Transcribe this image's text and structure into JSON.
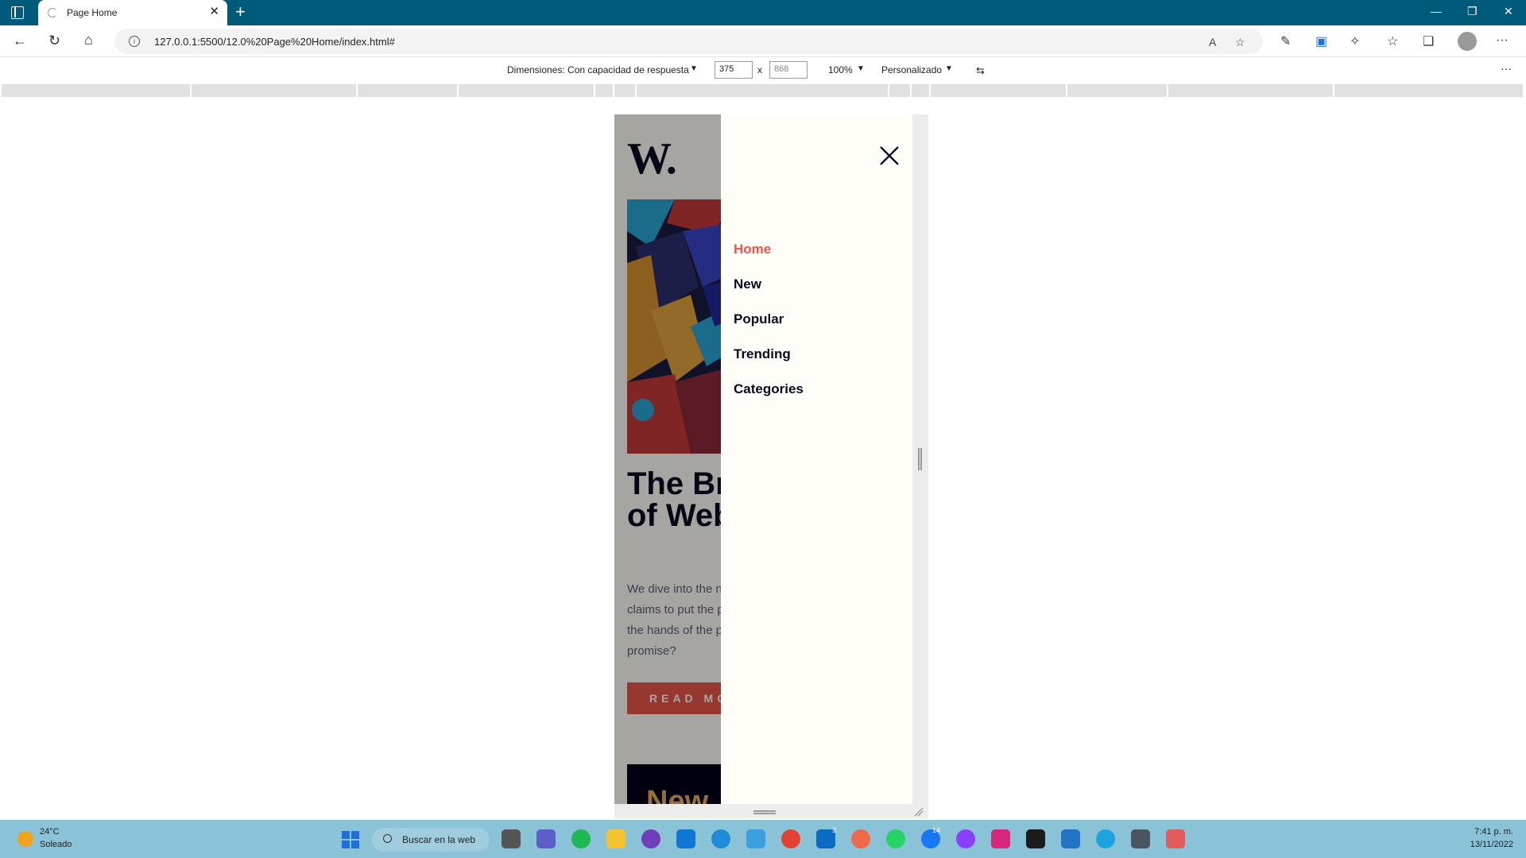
{
  "browser": {
    "tab_title": "Page Home",
    "tab_close": "✕",
    "new_tab": "+",
    "url": "127.0.0.1:5500/12.0%20Page%20Home/index.html#",
    "window_controls": [
      "—",
      "❐",
      "✕"
    ]
  },
  "devtools": {
    "dimensions_label": "Dimensiones: Con capacidad de respuesta",
    "width_value": "375",
    "height_value": "868",
    "times": "x",
    "zoom": "100%",
    "throttle": "Personalizado",
    "more": "···"
  },
  "page": {
    "logo": "W.",
    "headline": "The Bright Future of Web 3.0?",
    "lede": "We dive into the next evolution of the web that claims to put the power of the platforms back into the hands of the people. But is it really fulfilling its promise?",
    "read_more": "READ MORE",
    "new_section_title": "New",
    "menu": {
      "items": [
        {
          "label": "Home",
          "active": true
        },
        {
          "label": "New",
          "active": false
        },
        {
          "label": "Popular",
          "active": false
        },
        {
          "label": "Trending",
          "active": false
        },
        {
          "label": "Categories",
          "active": false
        }
      ]
    },
    "colors": {
      "accent": "#e9564a",
      "dark": "#0a0a1f",
      "cream": "#fffdf7",
      "gold": "#e9ab53"
    }
  },
  "taskbar": {
    "weather_temp": "24°C",
    "weather_desc": "Soleado",
    "search_placeholder": "Buscar en la web",
    "clock_time": "7:41 p. m.",
    "clock_date": "13/11/2022",
    "badges": {
      "mail": "3",
      "facebook": "14"
    }
  }
}
